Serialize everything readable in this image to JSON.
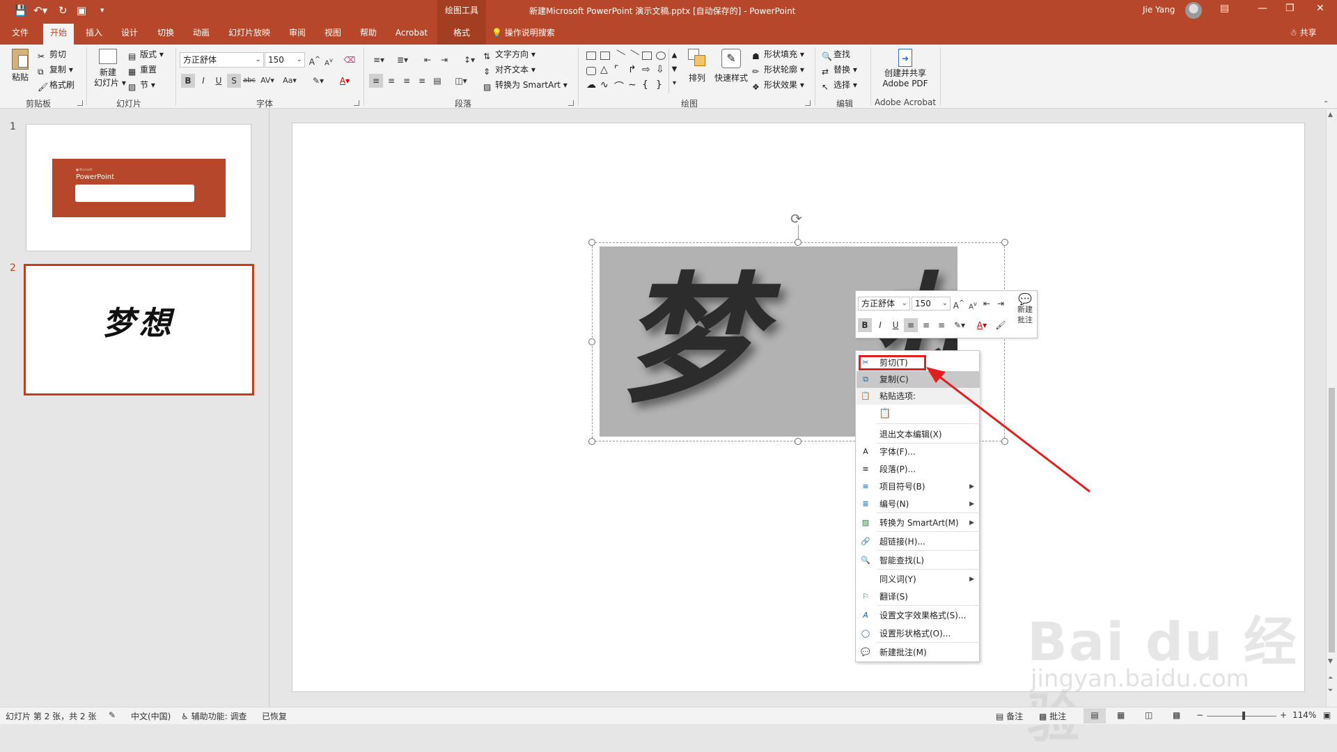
{
  "colors": {
    "accent": "#b7472a",
    "selection_border": "#c43e1c",
    "highlight_red": "#e02020"
  },
  "titlebar": {
    "drawing_tools": "绘图工具",
    "document_title": "新建Microsoft PowerPoint 演示文稿.pptx [自动保存的]  -  PowerPoint",
    "user": "Jie Yang",
    "quick_access_icons": [
      "save-icon",
      "undo-icon",
      "redo-icon",
      "start-from-beginning-icon",
      "customize-icon"
    ],
    "window_icons": [
      "ribbon-display-icon",
      "minimize-icon",
      "restore-icon",
      "close-icon"
    ]
  },
  "tabs": [
    "文件",
    "开始",
    "插入",
    "设计",
    "切换",
    "动画",
    "幻灯片放映",
    "审阅",
    "视图",
    "帮助",
    "Acrobat",
    "格式"
  ],
  "active_tab": "开始",
  "tell_me": "操作说明搜索",
  "share": "共享",
  "ribbon": {
    "clipboard": {
      "paste": "粘贴",
      "cut": "剪切",
      "copy": "复制",
      "format_painter": "格式刷",
      "label": "剪贴板"
    },
    "slides": {
      "new_slide_line1": "新建",
      "new_slide_line2": "幻灯片",
      "layout": "版式",
      "reset": "重置",
      "section": "节",
      "label": "幻灯片"
    },
    "font": {
      "name": "方正舒体",
      "size": "150",
      "label": "字体"
    },
    "paragraph": {
      "text_direction": "文字方向",
      "align_text": "对齐文本",
      "convert_smartart": "转换为 SmartArt",
      "label": "段落"
    },
    "drawing": {
      "arrange": "排列",
      "quick_styles": "快速样式",
      "shape_fill": "形状填充",
      "shape_outline": "形状轮廓",
      "shape_effects": "形状效果",
      "label": "绘图"
    },
    "editing": {
      "find": "查找",
      "replace": "替换",
      "select": "选择",
      "label": "编辑"
    },
    "acrobat": {
      "create_share_line1": "创建并共享",
      "create_share_line2": "Adobe PDF",
      "label": "Adobe Acrobat"
    }
  },
  "thumbnails": [
    {
      "number": "1",
      "title": "PowerPoint"
    },
    {
      "number": "2",
      "text": "梦想"
    }
  ],
  "slide": {
    "text": "梦 想"
  },
  "minibar": {
    "font": "方正舒体",
    "size": "150",
    "new_comment_line1": "新建",
    "new_comment_line2": "批注"
  },
  "context_menu": {
    "cut": "剪切(T)",
    "copy": "复制(C)",
    "paste_options": "粘贴选项:",
    "exit_edit": "退出文本编辑(X)",
    "font": "字体(F)...",
    "paragraph": "段落(P)...",
    "bullets": "项目符号(B)",
    "numbering": "编号(N)",
    "convert_smartart": "转换为 SmartArt(M)",
    "hyperlink": "超链接(H)...",
    "smart_lookup": "智能查找(L)",
    "synonyms": "同义词(Y)",
    "translate": "翻译(S)",
    "format_text_effects": "设置文字效果格式(S)...",
    "format_shape": "设置形状格式(O)...",
    "new_comment": "新建批注(M)"
  },
  "statusbar": {
    "slide_info": "幻灯片 第 2 张，共 2 张",
    "language": "中文(中国)",
    "accessibility": "辅助功能: 调查",
    "recovered": "已恢复",
    "notes": "备注",
    "comments": "批注",
    "zoom": "114%"
  },
  "watermark": {
    "logo": "Bai du 经验",
    "url": "jingyan.baidu.com"
  }
}
